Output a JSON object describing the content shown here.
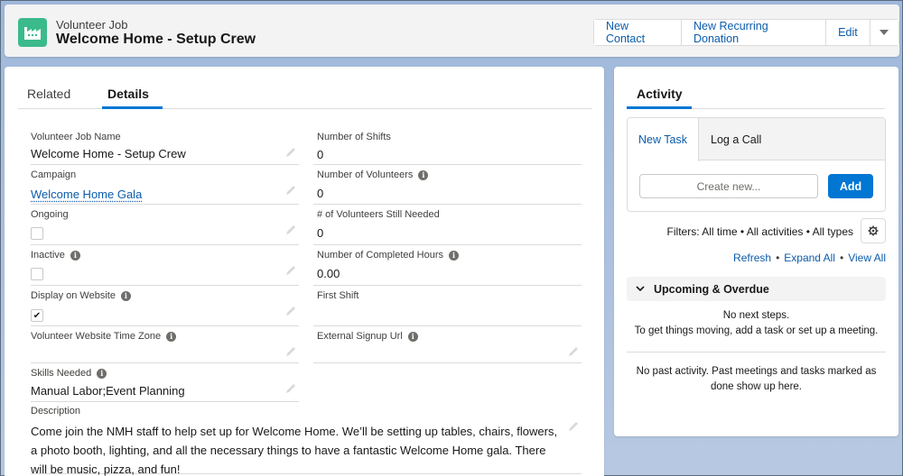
{
  "header": {
    "object_type": "Volunteer Job",
    "record_title": "Welcome Home - Setup Crew",
    "icon": "factory-icon",
    "icon_color": "#3bba8c",
    "actions": [
      "New Contact",
      "New Recurring Donation",
      "Edit"
    ],
    "more_actions_icon": "chevron-down-icon"
  },
  "tabs": {
    "items": [
      {
        "label": "Related",
        "active": false
      },
      {
        "label": "Details",
        "active": true
      }
    ]
  },
  "details": {
    "left": [
      {
        "label": "Volunteer Job Name",
        "value": "Welcome Home - Setup Crew",
        "type": "text",
        "info": false
      },
      {
        "label": "Campaign",
        "value": "Welcome Home Gala",
        "type": "link",
        "info": false
      },
      {
        "label": "Ongoing",
        "value": false,
        "type": "checkbox",
        "info": false
      },
      {
        "label": "Inactive",
        "value": false,
        "type": "checkbox",
        "info": true
      },
      {
        "label": "Display on Website",
        "value": true,
        "type": "checkbox",
        "info": true
      },
      {
        "label": "Volunteer Website Time Zone",
        "value": "",
        "type": "text",
        "info": true
      },
      {
        "label": "Skills Needed",
        "value": "Manual Labor;Event Planning",
        "type": "text",
        "info": true
      }
    ],
    "right": [
      {
        "label": "Number of Shifts",
        "value": "0",
        "info": false
      },
      {
        "label": "Number of Volunteers",
        "value": "0",
        "info": true
      },
      {
        "label": "# of Volunteers Still Needed",
        "value": "0",
        "info": false
      },
      {
        "label": "Number of Completed Hours",
        "value": "0.00",
        "info": true
      },
      {
        "label": "First Shift",
        "value": "",
        "info": false
      },
      {
        "label": "External Signup Url",
        "value": "",
        "info": true
      }
    ],
    "description": {
      "label": "Description",
      "value": "Come join the NMH staff to help set up for Welcome Home. We’ll be setting up tables, chairs, flowers, a photo booth, lighting, and all the necessary things to have a fantastic Welcome Home gala. There will be music, pizza, and fun!"
    }
  },
  "activity": {
    "tab_label": "Activity",
    "composer_tabs": [
      "New Task",
      "Log a Call"
    ],
    "create_placeholder": "Create new...",
    "add_label": "Add",
    "filters_text": "Filters: All time • All activities • All types",
    "links": [
      "Refresh",
      "Expand All",
      "View All"
    ],
    "upcoming_label": "Upcoming & Overdue",
    "no_next_steps_1": "No next steps.",
    "no_next_steps_2": "To get things moving, add a task or set up a meeting.",
    "no_past_activity": "No past activity. Past meetings and tasks marked as done show up here."
  },
  "colors": {
    "brand_blue": "#0176d3",
    "link_blue": "#0b5cab",
    "background": "#b0c4df"
  }
}
